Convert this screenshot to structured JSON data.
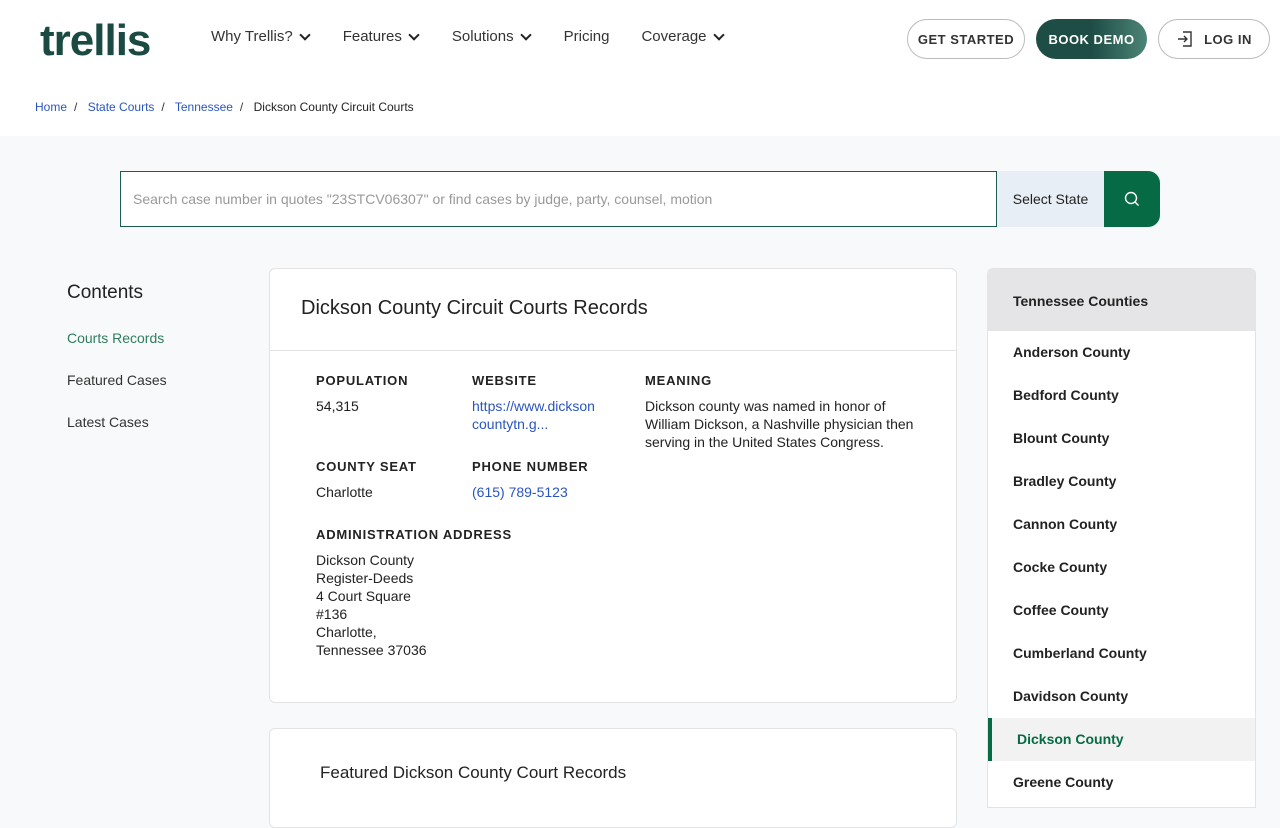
{
  "header": {
    "logo": "trellis",
    "nav": [
      "Why Trellis?",
      "Features",
      "Solutions",
      "Pricing",
      "Coverage"
    ],
    "get_started": "GET STARTED",
    "book_demo": "BOOK DEMO",
    "log_in": "LOG IN"
  },
  "breadcrumb": [
    "Home",
    "State Courts",
    "Tennessee",
    "Dickson County Circuit Courts"
  ],
  "search": {
    "placeholder": "Search case number in quotes \"23STCV06307\" or find cases by judge, party, counsel, motion",
    "select_state": "Select State"
  },
  "toc": {
    "title": "Contents",
    "items": [
      "Courts Records",
      "Featured Cases",
      "Latest Cases"
    ]
  },
  "card": {
    "title": "Dickson County Circuit Courts Records",
    "population_label": "POPULATION",
    "population": "54,315",
    "website_label": "WEBSITE",
    "website": "https://www.dicksoncountytn.g...",
    "meaning_label": "MEANING",
    "meaning": "Dickson county was named in honor of William Dickson, a Nashville physician then serving in the United States Congress.",
    "seat_label": "COUNTY SEAT",
    "seat": "Charlotte",
    "phone_label": "PHONE NUMBER",
    "phone": "(615) 789-5123",
    "address_label": "ADMINISTRATION ADDRESS",
    "address": [
      "Dickson County",
      "Register-Deeds",
      "4 Court Square",
      "#136",
      "Charlotte,",
      "Tennessee 37036"
    ]
  },
  "featured": {
    "title": "Featured Dickson County Court Records"
  },
  "counties": {
    "title": "Tennessee Counties",
    "items": [
      "Anderson County",
      "Bedford County",
      "Blount County",
      "Bradley County",
      "Cannon County",
      "Cocke County",
      "Coffee County",
      "Cumberland County",
      "Davidson County",
      "Dickson County",
      "Greene County"
    ],
    "active": "Dickson County"
  }
}
